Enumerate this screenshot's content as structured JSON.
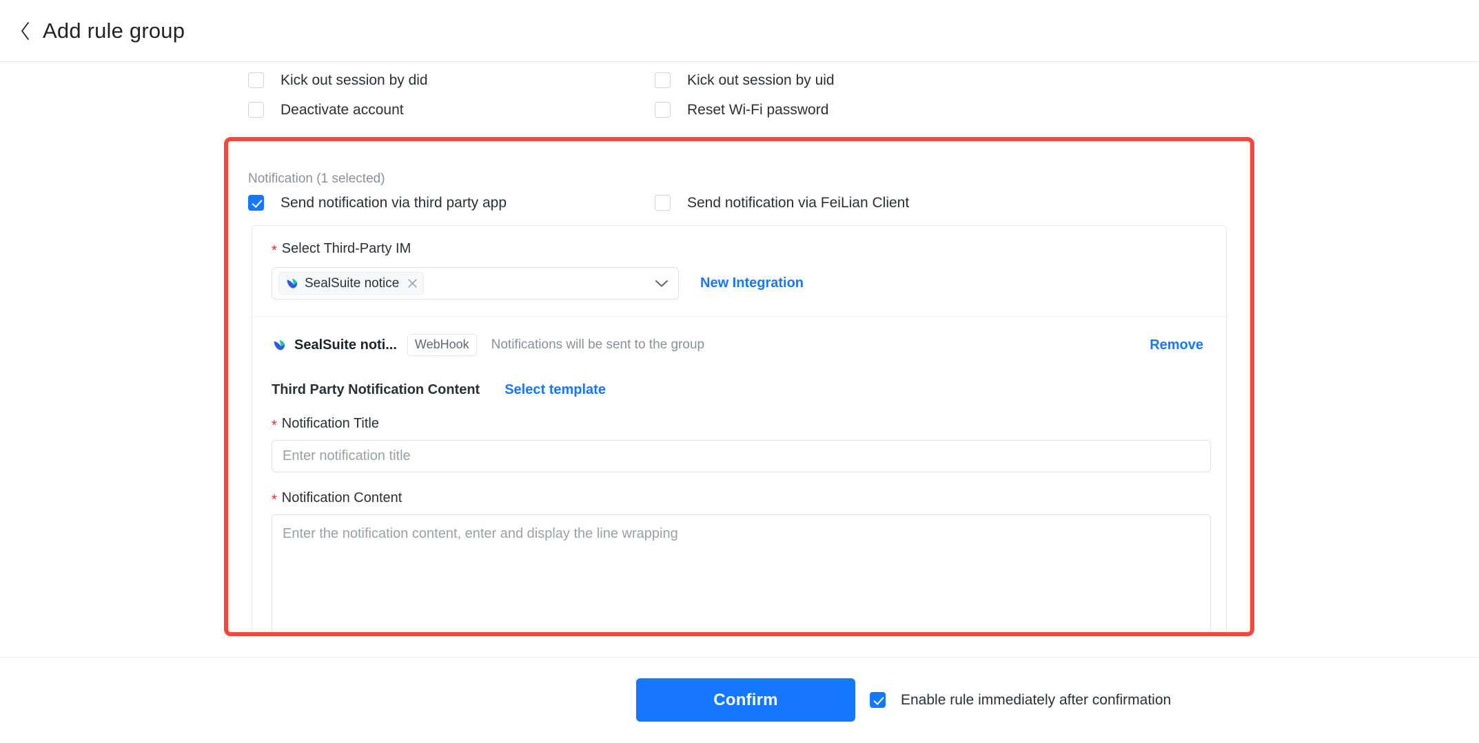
{
  "header": {
    "back_icon": "chevron-left-icon",
    "title": "Add rule group"
  },
  "actions_section": {
    "rows": [
      [
        {
          "label": "Kick out session by did",
          "checked": false
        },
        {
          "label": "Kick out session by uid",
          "checked": false
        }
      ],
      [
        {
          "label": "Deactivate account",
          "checked": false
        },
        {
          "label": "Reset Wi-Fi password",
          "checked": false
        }
      ]
    ]
  },
  "notification_section": {
    "legend": "Notification (1 selected)",
    "options": [
      {
        "label": "Send notification via third party app",
        "checked": true
      },
      {
        "label": "Send notification via FeiLian Client",
        "checked": false
      }
    ],
    "integration_card": {
      "select_label": "Select Third-Party IM",
      "select_required": true,
      "required_marker": "*",
      "selected_tags": [
        {
          "label": "SealSuite notice",
          "logo_icon": "sealsuite-logo-icon",
          "remove_icon": "close-icon"
        }
      ],
      "dropdown_icon": "chevron-down-icon",
      "new_integration_label": "New Integration",
      "webhook_row": {
        "logo_icon": "sealsuite-logo-icon",
        "name": "SealSuite noti...",
        "badge": "WebHook",
        "description": "Notifications will be sent to the group",
        "remove_label": "Remove"
      },
      "content_section": {
        "title": "Third Party Notification Content",
        "select_template_label": "Select template",
        "notification_title": {
          "label": "Notification Title",
          "required_marker": "*",
          "value": "",
          "placeholder": "Enter notification title"
        },
        "notification_content": {
          "label": "Notification Content",
          "required_marker": "*",
          "value": "",
          "placeholder": "Enter the notification content, enter and display the line wrapping"
        }
      }
    }
  },
  "footer": {
    "confirm_label": "Confirm",
    "enable_rule": {
      "label": "Enable rule immediately after confirmation",
      "checked": true
    }
  },
  "colors": {
    "accent_blue": "#1677ff",
    "highlight_red": "#f4483f",
    "required_red": "#f5222d",
    "text_primary": "#1f2329",
    "text_secondary": "#8a9099",
    "border": "#dfe3e8"
  }
}
